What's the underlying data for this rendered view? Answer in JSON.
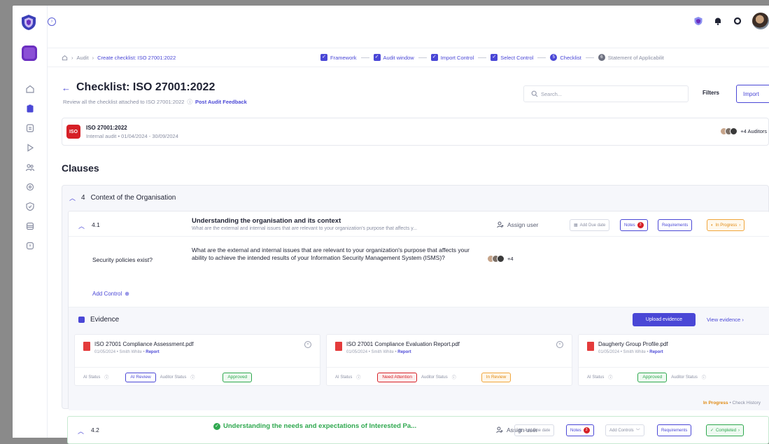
{
  "breadcrumb": {
    "home": "Audit",
    "sep": "›",
    "current": "Create checklist: ISO 27001:2022"
  },
  "steps": [
    {
      "label": "Framework",
      "state": "done"
    },
    {
      "label": "Audit window",
      "state": "done"
    },
    {
      "label": "Import Control",
      "state": "done"
    },
    {
      "label": "Select Control",
      "state": "done"
    },
    {
      "label": "Checklist",
      "state": "current",
      "num": "5"
    },
    {
      "label": "Statement of Applicabilit",
      "state": "pending",
      "num": "6"
    }
  ],
  "header": {
    "title": "Checklist: ISO 27001:2022",
    "subtitle": "Review all the checklist attached to ISO 27001:2022",
    "feedback_link": "Post Audit Feedback"
  },
  "search": {
    "placeholder": "Search..."
  },
  "toolbar": {
    "filters": "Filters",
    "import": "Import"
  },
  "framework": {
    "badge": "ISO",
    "name": "ISO 27001:2022",
    "meta": "Internal audit • 01/04/2024 - 30/09/2024",
    "auditors": "+4 Auditors"
  },
  "clauses_heading": "Clauses",
  "section": {
    "number": "4",
    "title": "Context of the Organisation"
  },
  "clause_41": {
    "number": "4.1",
    "title": "Understanding the organisation and its context",
    "desc": "What are the external and internal issues that are relevant to your organization's purpose that affects y...",
    "assign": "Assign user",
    "due": "Add Due date",
    "notes": "Notes",
    "notes_count": "3",
    "requirements": "Requirements",
    "status": "In Progress",
    "question_label": "Security policies exist?",
    "question": "What are the external and internal issues that are relevant to your organization's purpose that affects your ability to achieve the intended results of your Information Security Management System (ISMS)?",
    "question_auditors": "+4",
    "add_control": "Add Control"
  },
  "evidence": {
    "title": "Evidence",
    "upload": "Upload evidence",
    "view": "View evidence",
    "ai_status": "AI Status",
    "auditor_status": "Auditor Status",
    "files": [
      {
        "name": "ISO 27001 Compliance Assessment.pdf",
        "date": "01/05/2024",
        "owner": "Smith White",
        "link": "Report",
        "ai": "AI Review",
        "auditor": "Approved"
      },
      {
        "name": "ISO 27001 Compliance Evaluation Report.pdf",
        "date": "01/05/2024",
        "owner": "Smith White",
        "link": "Report",
        "ai": "Need Attention",
        "auditor": "In Review"
      },
      {
        "name": "Daugherty Group Profile.pdf",
        "date": "01/05/2024",
        "owner": "Smith White",
        "link": "Report",
        "ai": "Approved",
        "auditor": ""
      }
    ],
    "footer_status": "In Progress",
    "footer_link": "Check History"
  },
  "clause_42": {
    "number": "4.2",
    "title": "Understanding the needs and expectations of Interested Pa...",
    "assign": "Assign user",
    "due": "Add Due date",
    "notes": "Notes",
    "notes_count": "3",
    "controls": "Add Controls",
    "requirements": "Requirements",
    "status": "Completed"
  },
  "colors": {
    "accent": "#4a47d6",
    "success": "#2fa84f",
    "warning": "#e08a12",
    "danger": "#d62027"
  },
  "icons": [
    "shield-icon",
    "home-icon",
    "clipboard-icon",
    "file-icon",
    "play-icon",
    "users-icon",
    "settings-icon",
    "badge-icon",
    "database-icon",
    "info-icon",
    "bell-icon",
    "circle-icon"
  ]
}
